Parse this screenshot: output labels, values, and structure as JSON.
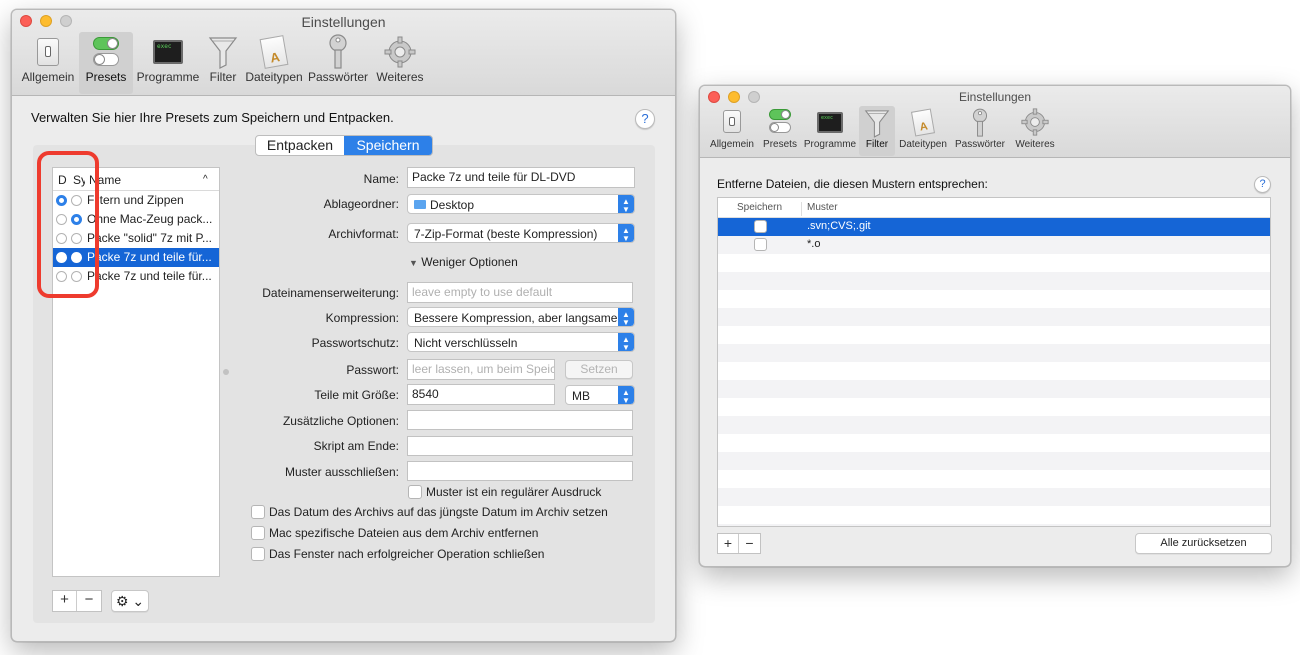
{
  "colors": {
    "accent": "#2d80e8",
    "selection": "#1565d6",
    "highlight_ring": "#ee3b2e",
    "close": "#fc5f57",
    "minimize": "#fdbc2e",
    "zoom": "#c8c8c8"
  },
  "left_window": {
    "title": "Einstellungen",
    "toolbar": [
      {
        "label": "Allgemein",
        "icon": "switch-icon"
      },
      {
        "label": "Presets",
        "icon": "toggles-icon"
      },
      {
        "label": "Programme",
        "icon": "terminal-icon"
      },
      {
        "label": "Filter",
        "icon": "funnel-icon"
      },
      {
        "label": "Dateitypen",
        "icon": "document-icon"
      },
      {
        "label": "Passwörter",
        "icon": "key-icon"
      },
      {
        "label": "Weiteres",
        "icon": "gear-icon"
      }
    ],
    "selected_tab": "Presets",
    "description": "Verwalten Sie hier Ihre Presets zum Speichern und Entpacken.",
    "help_symbol": "?",
    "segments": [
      "Entpacken",
      "Speichern"
    ],
    "preset_list": {
      "headers": {
        "d": "D",
        "s": "Sy",
        "name": "Name",
        "sort_arrow": "^"
      },
      "rows": [
        {
          "name": "Filtern und Zippen",
          "d": true,
          "s": false,
          "selected": false
        },
        {
          "name": "Ohne Mac-Zeug pack...",
          "d": false,
          "s": true,
          "selected": false
        },
        {
          "name": "Packe \"solid\" 7z mit P...",
          "d": false,
          "s": false,
          "selected": false
        },
        {
          "name": "Packe 7z und teile für...",
          "d": false,
          "s": false,
          "selected": true
        },
        {
          "name": "Packe 7z und teile für...",
          "d": false,
          "s": false,
          "selected": false
        }
      ]
    },
    "list_buttons": {
      "add": "+",
      "remove": "−",
      "gear_menu": "⚙ ⌄"
    },
    "form": {
      "name": {
        "label": "Name:",
        "value": "Packe 7z und teile für DL-DVD"
      },
      "folder": {
        "label": "Ablageordner:",
        "value": "Desktop"
      },
      "format": {
        "label": "Archivformat:",
        "value": "7-Zip-Format (beste Kompression)"
      },
      "fewer_options": "Weniger Optionen",
      "extension": {
        "label": "Dateinamenserweiterung:",
        "placeholder": "leave empty to use default"
      },
      "compression": {
        "label": "Kompression:",
        "value": "Bessere Kompression, aber langsamer"
      },
      "password_protection": {
        "label": "Passwortschutz:",
        "value": "Nicht verschlüsseln"
      },
      "password": {
        "label": "Passwort:",
        "placeholder": "leer lassen, um beim Speic",
        "set_button": "Setzen"
      },
      "split": {
        "label": "Teile mit Größe:",
        "value": "8540",
        "unit": "MB"
      },
      "additional_options": {
        "label": "Zusätzliche Optionen:",
        "value": ""
      },
      "script_end": {
        "label": "Skript am Ende:",
        "value": ""
      },
      "exclude_pattern": {
        "label": "Muster ausschließen:",
        "value": ""
      },
      "regex_checkbox": "Muster ist ein regulärer Ausdruck",
      "checkboxes": [
        "Das Datum des Archivs auf das jüngste Datum im Archiv setzen",
        "Mac spezifische Dateien aus dem Archiv entfernen",
        "Das Fenster nach erfolgreicher Operation schließen"
      ]
    }
  },
  "right_window": {
    "title": "Einstellungen",
    "toolbar": [
      {
        "label": "Allgemein",
        "icon": "switch-icon"
      },
      {
        "label": "Presets",
        "icon": "toggles-icon"
      },
      {
        "label": "Programme",
        "icon": "terminal-icon"
      },
      {
        "label": "Filter",
        "icon": "funnel-icon"
      },
      {
        "label": "Dateitypen",
        "icon": "document-icon"
      },
      {
        "label": "Passwörter",
        "icon": "key-icon"
      },
      {
        "label": "Weiteres",
        "icon": "gear-icon"
      }
    ],
    "selected_tab": "Filter",
    "description": "Entferne Dateien, die diesen Mustern entsprechen:",
    "help_symbol": "?",
    "table": {
      "headers": [
        "Speichern",
        "Muster"
      ],
      "rows": [
        {
          "save": false,
          "pattern": ".svn;CVS;.git",
          "selected": true
        },
        {
          "save": false,
          "pattern": "*.o",
          "selected": false
        }
      ]
    },
    "buttons": {
      "add": "+",
      "remove": "−",
      "reset": "Alle zurücksetzen"
    }
  }
}
